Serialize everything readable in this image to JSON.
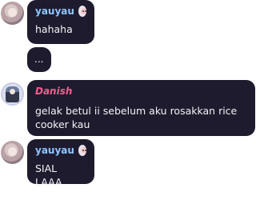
{
  "messages": [
    {
      "author": "yauyau",
      "text": "hahaha",
      "author_color": "#8ec6ff",
      "avatar_icon": "user-avatar-icon",
      "badge_icon": "character-badge-icon"
    },
    {
      "author": "",
      "text": "...",
      "typing": true
    },
    {
      "author": "Danish",
      "text": "gelak betul ii sebelum aku rosakkan rice cooker kau",
      "author_color": "#f45d8d",
      "avatar_icon": "user-avatar-icon"
    },
    {
      "author": "yauyau",
      "text": "SIAL LAAA",
      "author_color": "#8ec6ff",
      "avatar_icon": "user-avatar-icon",
      "badge_icon": "character-badge-icon"
    }
  ],
  "theme": {
    "bubble_bg": "#1e1b2e",
    "page_bg": "#ffffff",
    "text": "#f3f3f6"
  }
}
